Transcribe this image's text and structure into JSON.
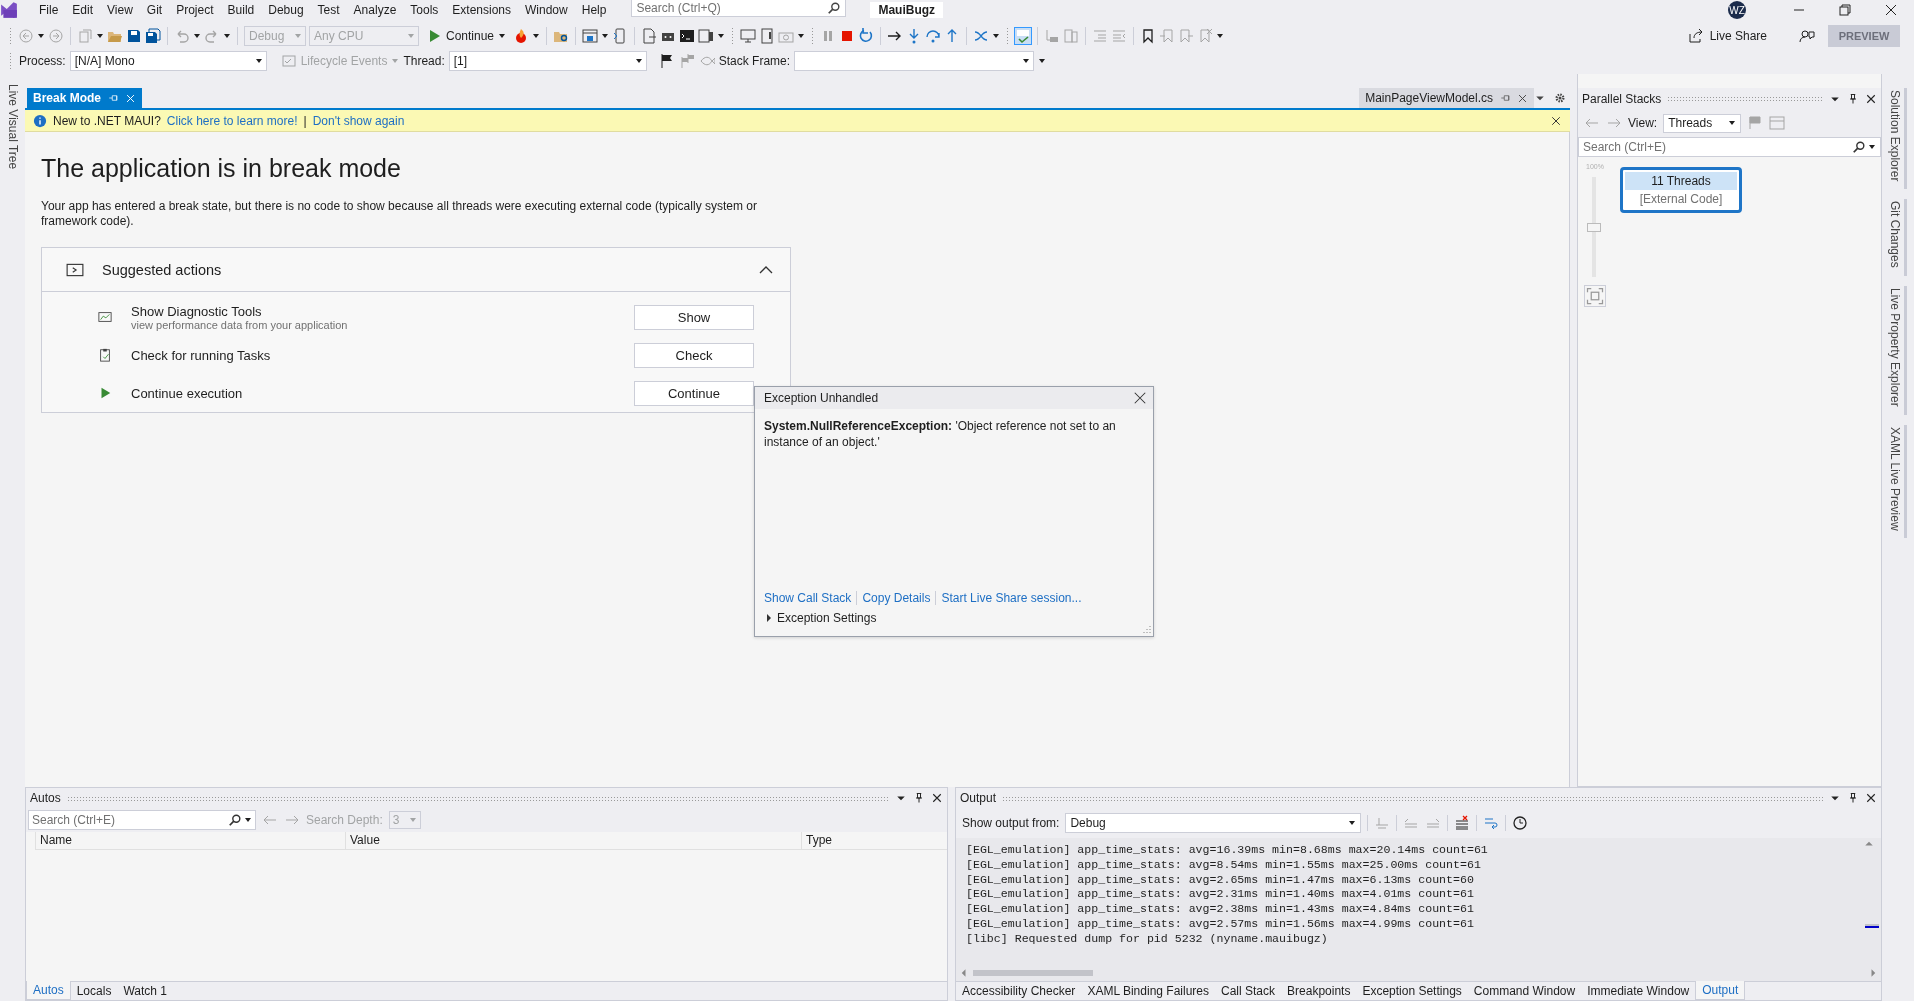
{
  "title_bar": {
    "menu": [
      "File",
      "Edit",
      "View",
      "Git",
      "Project",
      "Build",
      "Debug",
      "Test",
      "Analyze",
      "Tools",
      "Extensions",
      "Window",
      "Help"
    ],
    "search": {
      "placeholder": "Search (Ctrl+Q)"
    },
    "solution": "MauiBugz",
    "avatar": "WZ",
    "live_share": "Live Share",
    "preview": "PREVIEW"
  },
  "toolbar": {
    "configuration": {
      "value": "Debug",
      "disabled": true
    },
    "platform": {
      "value": "Any CPU",
      "disabled": true
    },
    "continue": "Continue"
  },
  "debug_location": {
    "process_label": "Process:",
    "process": "[N/A] Mono",
    "lifecycle": {
      "label": "Lifecycle Events",
      "disabled": true
    },
    "thread_label": "Thread:",
    "thread": "[1]",
    "stack_frame_label": "Stack Frame:"
  },
  "left_tabs": [
    "Live Visual Tree"
  ],
  "document": {
    "tabs": [
      {
        "label": "Break Mode",
        "selected": true
      },
      {
        "label": "MainPageViewModel.cs",
        "selected": false
      }
    ],
    "info_bar": {
      "text": "New to .NET MAUI?",
      "links": [
        "Click here to learn more!",
        "Don't show again"
      ],
      "separator": "|"
    },
    "heading": "The application is in break mode",
    "description": "Your app has entered a break state, but there is no code to show because all threads were executing external code (typically system or framework code).",
    "suggested": {
      "title": "Suggested actions",
      "expanded": true,
      "actions": [
        {
          "kind": "diagnostics",
          "title": "Show Diagnostic Tools",
          "subtitle": "view performance data from your application",
          "button": "Show"
        },
        {
          "kind": "tasks",
          "title": "Check for running Tasks",
          "button": "Check"
        },
        {
          "kind": "continue",
          "title": "Continue execution",
          "button": "Continue"
        }
      ]
    }
  },
  "exception": {
    "title": "Exception Unhandled",
    "message": "**System.NullReferenceException:** 'Object reference not set to an instance of an object.'",
    "links": [
      "Show Call Stack",
      "Copy Details",
      "Start Live Share session..."
    ],
    "settings": {
      "label": "Exception Settings",
      "expanded": false
    }
  },
  "parallel_stacks": {
    "title": "Parallel Stacks",
    "view_label": "View:",
    "view": "Threads",
    "search": {
      "placeholder": "Search (Ctrl+E)"
    },
    "zoom": {
      "label": "100%",
      "level": 0.5
    },
    "node": {
      "header": "11 Threads",
      "frames": [
        "[External Code]"
      ]
    }
  },
  "right_tabs": [
    "Solution Explorer",
    "Git Changes",
    "Live Property Explorer",
    "XAML Live Preview"
  ],
  "autos": {
    "title": "Autos",
    "search": {
      "placeholder": "Search (Ctrl+E)"
    },
    "search_depth": {
      "label": "Search Depth:",
      "value": "3",
      "disabled": true
    },
    "columns": [
      "Name",
      "Value",
      "Type"
    ],
    "tabs": [
      {
        "label": "Autos",
        "selected": true
      },
      {
        "label": "Locals",
        "selected": false
      },
      {
        "label": "Watch 1",
        "selected": false
      }
    ]
  },
  "output": {
    "title": "Output",
    "source_label": "Show output from:",
    "source": "Debug",
    "lines": [
      "[EGL_emulation] app_time_stats: avg=16.39ms min=8.68ms max=20.14ms count=61",
      "[EGL_emulation] app_time_stats: avg=8.54ms min=1.55ms max=25.00ms count=61",
      "[EGL_emulation] app_time_stats: avg=2.65ms min=1.47ms max=6.13ms count=60",
      "[EGL_emulation] app_time_stats: avg=2.31ms min=1.40ms max=4.01ms count=61",
      "[EGL_emulation] app_time_stats: avg=2.38ms min=1.43ms max=4.84ms count=61",
      "[EGL_emulation] app_time_stats: avg=2.57ms min=1.56ms max=4.99ms count=61",
      "[libc] Requested dump for pid 5232 (nyname.mauibugz)"
    ],
    "tabs": [
      {
        "label": "Accessibility Checker",
        "selected": false
      },
      {
        "label": "XAML Binding Failures",
        "selected": false
      },
      {
        "label": "Call Stack",
        "selected": false
      },
      {
        "label": "Breakpoints",
        "selected": false
      },
      {
        "label": "Exception Settings",
        "selected": false
      },
      {
        "label": "Command Window",
        "selected": false
      },
      {
        "label": "Immediate Window",
        "selected": false
      },
      {
        "label": "Output",
        "selected": true
      }
    ]
  }
}
